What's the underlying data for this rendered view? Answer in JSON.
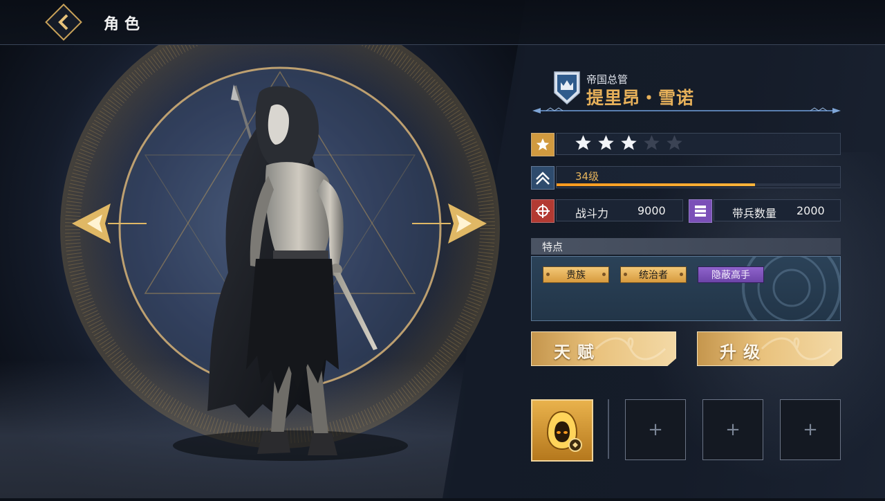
{
  "header": {
    "title": "角色"
  },
  "character": {
    "subtitle": "帝国总管",
    "name": "提里昂・雪诺",
    "star_rating": 3,
    "star_max": 5,
    "level_label": "34级",
    "xp_progress": 0.7
  },
  "stats": {
    "power_label": "战斗力",
    "power_value": "9000",
    "troops_label": "带兵数量",
    "troops_value": "2000"
  },
  "traits": {
    "header": "特点",
    "items": [
      {
        "label": "贵族",
        "style": "gold"
      },
      {
        "label": "统治者",
        "style": "gold"
      },
      {
        "label": "隐蔽高手",
        "style": "purple"
      }
    ]
  },
  "actions": {
    "talent_label": "天赋",
    "upgrade_label": "升级"
  },
  "equipment_slots": [
    {
      "state": "filled",
      "icon": "hooded-figure-icon"
    },
    {
      "state": "empty",
      "icon": "plus-icon",
      "symbol": "+"
    },
    {
      "state": "empty",
      "icon": "plus-icon",
      "symbol": "+"
    },
    {
      "state": "empty",
      "icon": "plus-icon",
      "symbol": "+"
    }
  ],
  "colors": {
    "gold": "#e7b15a",
    "xp_bar": "#ff9a1e",
    "trait_purple": "#7b50b8",
    "trait_gold": "#e2a94c",
    "power_icon": "#b33a32",
    "troops_icon": "#7b50b8",
    "level_icon": "#2e4b6d"
  }
}
